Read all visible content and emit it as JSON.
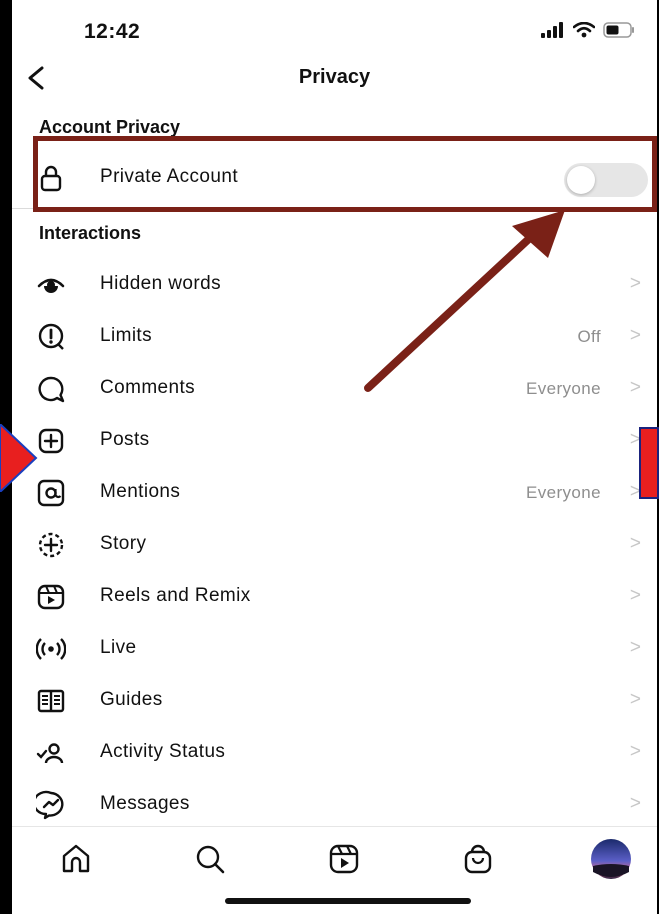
{
  "status_bar": {
    "time": "12:42"
  },
  "nav": {
    "title": "Privacy"
  },
  "sections": {
    "account_privacy": "Account Privacy",
    "interactions": "Interactions"
  },
  "private_account": {
    "label": "Private Account",
    "enabled": false
  },
  "rows": [
    {
      "label": "Hidden words",
      "value": "",
      "icon": "eye-icon"
    },
    {
      "label": "Limits",
      "value": "Off",
      "icon": "limits-icon"
    },
    {
      "label": "Comments",
      "value": "Everyone",
      "icon": "comment-icon"
    },
    {
      "label": "Posts",
      "value": "",
      "icon": "plus-square-icon"
    },
    {
      "label": "Mentions",
      "value": "Everyone",
      "icon": "at-icon"
    },
    {
      "label": "Story",
      "value": "",
      "icon": "story-add-icon"
    },
    {
      "label": "Reels and Remix",
      "value": "",
      "icon": "reels-icon"
    },
    {
      "label": "Live",
      "value": "",
      "icon": "live-icon"
    },
    {
      "label": "Guides",
      "value": "",
      "icon": "guides-icon"
    },
    {
      "label": "Activity Status",
      "value": "",
      "icon": "activity-status-icon"
    },
    {
      "label": "Messages",
      "value": "",
      "icon": "messenger-icon"
    }
  ],
  "chevron": ">",
  "colors": {
    "annotation_box": "#7a2117",
    "annotation_arrow": "#7a2117",
    "red_marker": "#e81f1f",
    "blue_marker": "#1a3fbf"
  },
  "tab_bar": [
    "home-icon",
    "search-icon",
    "reels-icon",
    "shop-icon",
    "profile-avatar"
  ]
}
